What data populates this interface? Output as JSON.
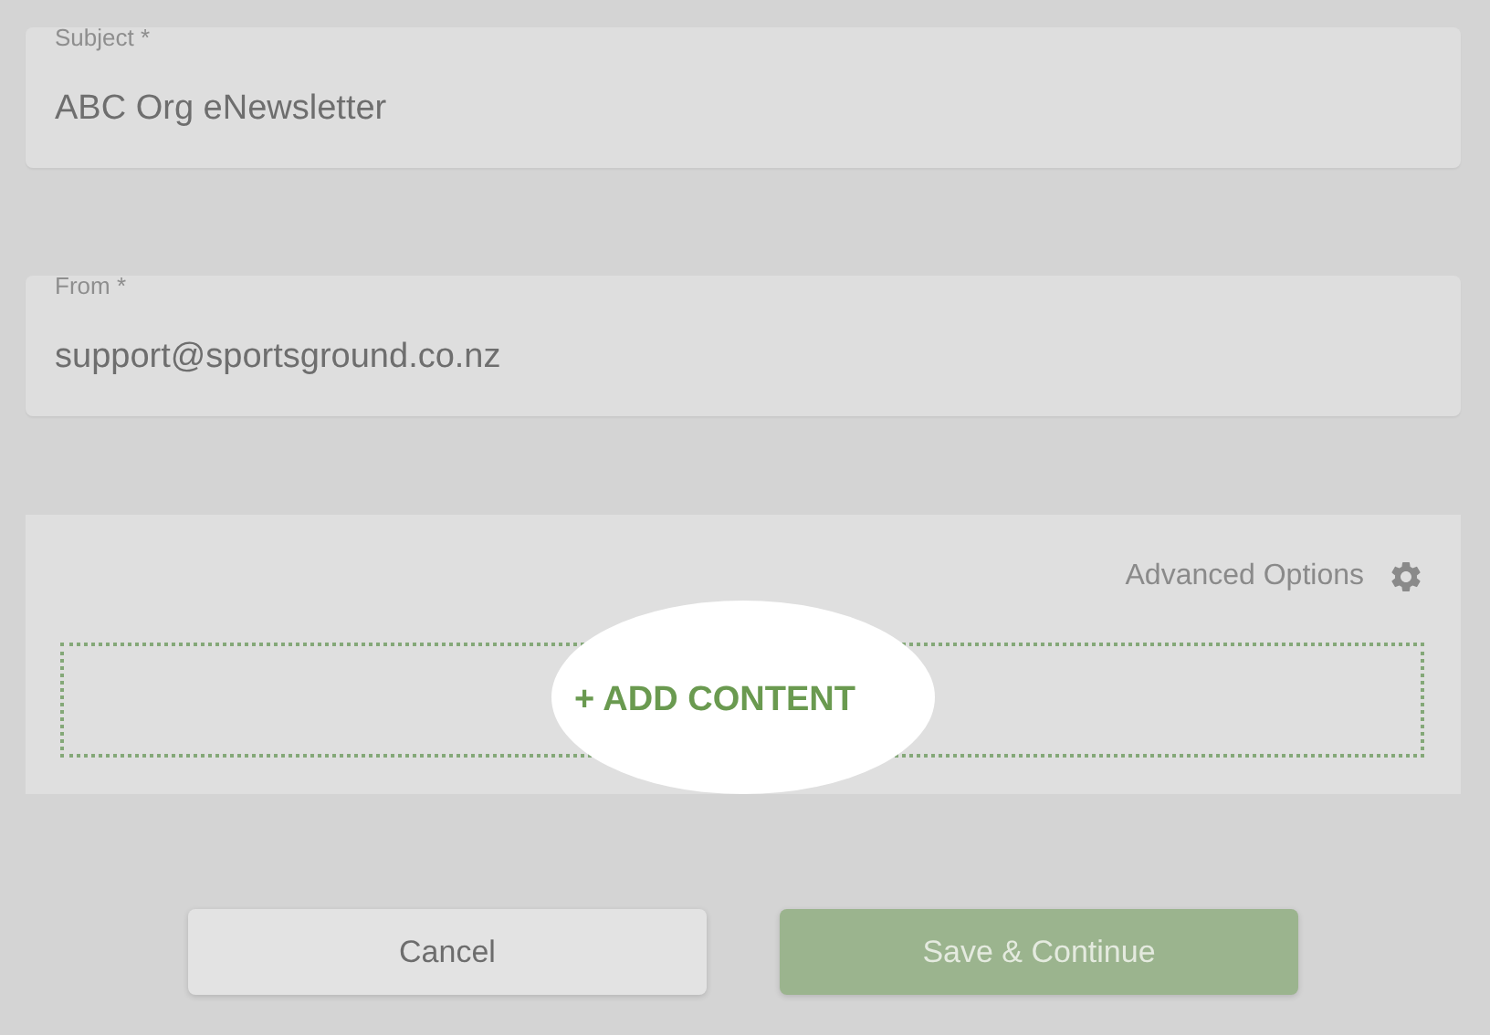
{
  "fields": [
    {
      "label": "Subject *",
      "value": "ABC Org eNewsletter"
    },
    {
      "label": "From *",
      "value": "support@sportsground.co.nz"
    }
  ],
  "content_panel": {
    "advanced_options": "Advanced Options",
    "add_content": "+ ADD CONTENT"
  },
  "buttons": [
    {
      "label": "Cancel",
      "kind": "secondary"
    },
    {
      "label": "Save & Continue",
      "kind": "primary"
    }
  ]
}
